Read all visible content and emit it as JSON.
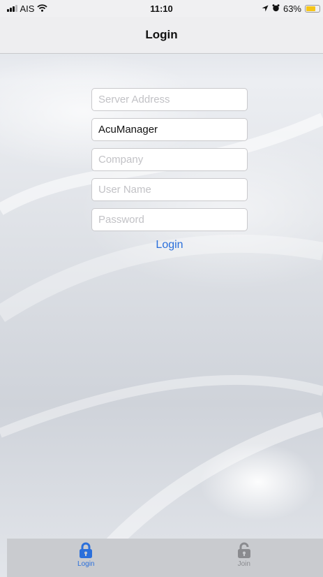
{
  "status_bar": {
    "carrier": "AIS",
    "time": "11:10",
    "battery_percent": "63%",
    "battery_level": 0.63,
    "icons": [
      "signal-icon",
      "wifi-icon",
      "location-icon",
      "alarm-icon",
      "battery-icon"
    ]
  },
  "nav": {
    "title": "Login"
  },
  "form": {
    "server_address": {
      "value": "",
      "placeholder": "Server Address"
    },
    "database": {
      "value": "AcuManager",
      "placeholder": ""
    },
    "company": {
      "value": "",
      "placeholder": "Company"
    },
    "username": {
      "value": "",
      "placeholder": "User Name"
    },
    "password": {
      "value": "",
      "placeholder": "Password"
    },
    "login_label": "Login"
  },
  "tabs": [
    {
      "label": "Login",
      "icon": "lock-closed-icon",
      "active": true
    },
    {
      "label": "Join",
      "icon": "lock-open-icon",
      "active": false
    }
  ],
  "colors": {
    "accent": "#2a6fdb",
    "tab_bar": "#c9cbcf",
    "inactive_tab": "#8a8b8f",
    "battery": "#f5c518"
  }
}
